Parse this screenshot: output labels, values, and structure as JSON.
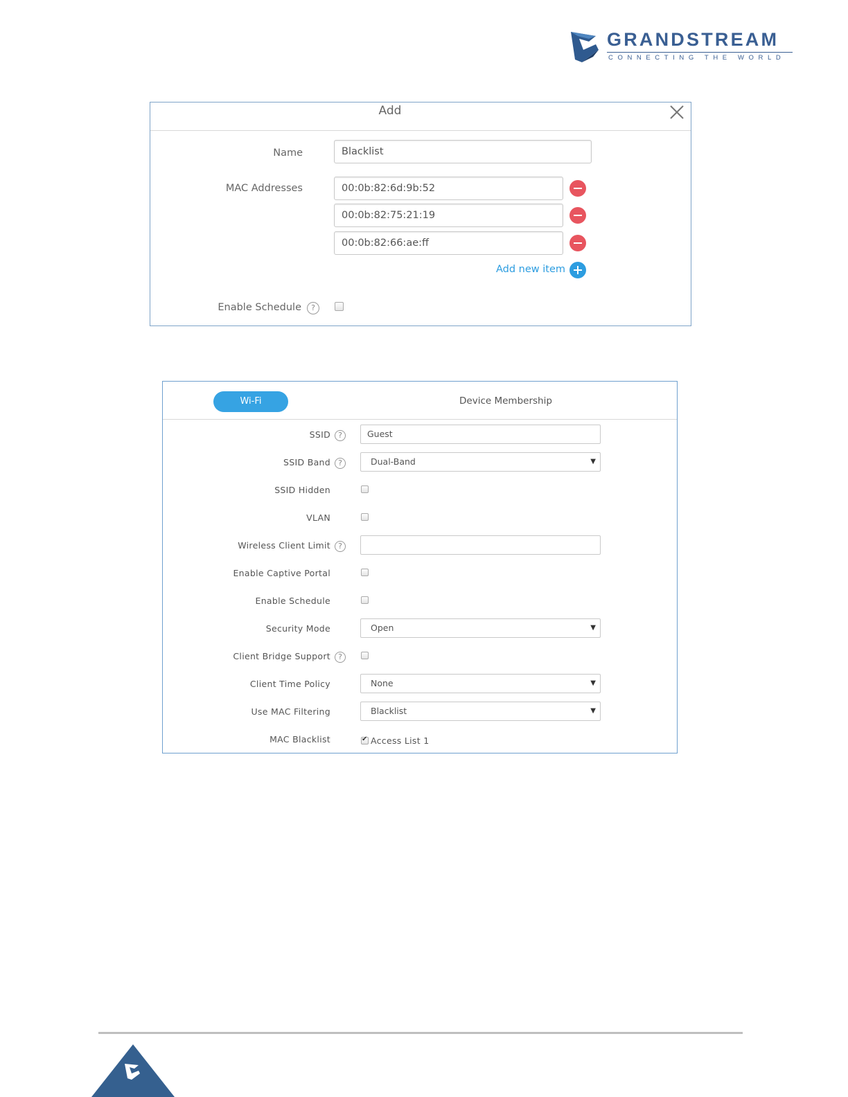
{
  "brand": {
    "name": "GRANDSTREAM",
    "tagline": "CONNECTING THE WORLD",
    "color": "#3a5f93"
  },
  "add_dialog": {
    "title": "Add",
    "close_icon": "close-icon",
    "name_label": "Name",
    "name_value": "Blacklist",
    "mac_label": "MAC Addresses",
    "mac_addresses": [
      "00:0b:82:6d:9b:52",
      "00:0b:82:75:21:19",
      "00:0b:82:66:ae:ff"
    ],
    "add_new_item": "Add new item",
    "enable_schedule_label": "Enable Schedule",
    "help_glyph": "?",
    "enable_schedule_checked": false
  },
  "wifi_panel": {
    "tabs": [
      {
        "label": "Wi-Fi",
        "active": true
      },
      {
        "label": "Device Membership",
        "active": false
      }
    ],
    "fields": {
      "ssid": {
        "label": "SSID",
        "value": "Guest"
      },
      "ssid_band": {
        "label": "SSID Band",
        "value": "Dual-Band"
      },
      "ssid_hidden": {
        "label": "SSID Hidden",
        "checked": false
      },
      "vlan": {
        "label": "VLAN",
        "checked": false
      },
      "wireless_client_limit": {
        "label": "Wireless Client Limit",
        "value": ""
      },
      "enable_captive_portal": {
        "label": "Enable Captive Portal",
        "checked": false
      },
      "enable_schedule": {
        "label": "Enable Schedule",
        "checked": false
      },
      "security_mode": {
        "label": "Security Mode",
        "value": "Open"
      },
      "client_bridge_support": {
        "label": "Client Bridge Support",
        "checked": false
      },
      "client_time_policy": {
        "label": "Client Time Policy",
        "value": "None"
      },
      "use_mac_filtering": {
        "label": "Use MAC Filtering",
        "value": "Blacklist"
      },
      "mac_blacklist": {
        "label": "MAC Blacklist",
        "option": "Access List 1",
        "checked": true
      }
    },
    "dropdown_arrow": "▼",
    "help_glyph": "?"
  },
  "colors": {
    "accent_blue": "#36a3e3",
    "remove_red": "#e8555f",
    "dialog_border": "#7fa4c8"
  }
}
